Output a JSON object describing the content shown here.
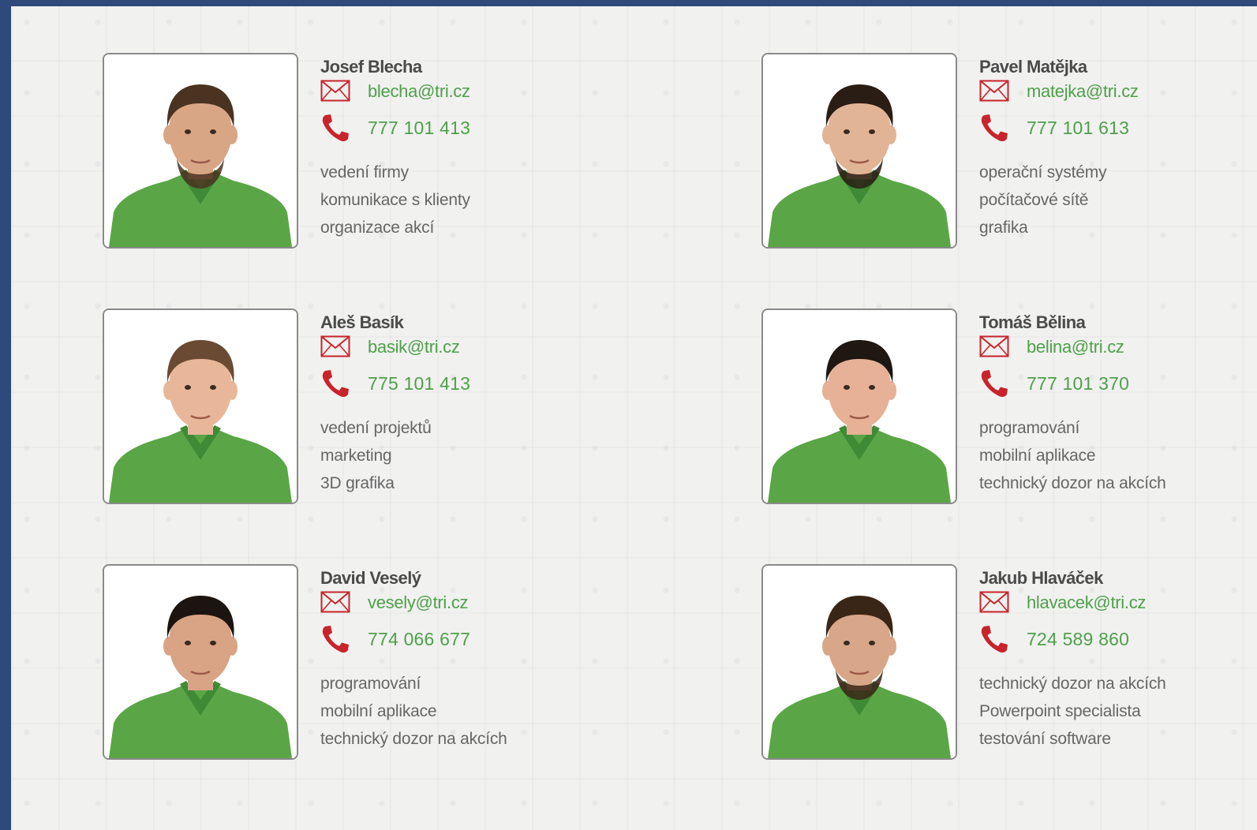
{
  "accent_green": "#4ea04a",
  "phone_red": "#c8242b",
  "people": [
    {
      "name": "Josef Blecha",
      "email": "blecha@tri.cz",
      "phone": "777 101 413",
      "skills": [
        "vedení firmy",
        "komunikace s klienty",
        "organizace akcí"
      ],
      "photo_icon": "person-photo"
    },
    {
      "name": "Pavel Matějka",
      "email": "matejka@tri.cz",
      "phone": "777 101 613",
      "skills": [
        "operační systémy",
        "počítačové sítě",
        "grafika"
      ],
      "photo_icon": "person-photo"
    },
    {
      "name": "Aleš Basík",
      "email": "basik@tri.cz",
      "phone": "775 101 413",
      "skills": [
        "vedení projektů",
        "marketing",
        "3D grafika"
      ],
      "photo_icon": "person-photo"
    },
    {
      "name": "Tomáš Bělina",
      "email": "belina@tri.cz",
      "phone": "777 101 370",
      "skills": [
        "programování",
        "mobilní aplikace",
        "technický dozor na akcích"
      ],
      "photo_icon": "person-photo"
    },
    {
      "name": "David Veselý",
      "email": "vesely@tri.cz",
      "phone": "774 066 677",
      "skills": [
        "programování",
        "mobilní aplikace",
        "technický dozor na akcích"
      ],
      "photo_icon": "person-photo"
    },
    {
      "name": "Jakub Hlaváček",
      "email": "hlavacek@tri.cz",
      "phone": "724 589 860",
      "skills": [
        "technický dozor na akcích",
        "Powerpoint specialista",
        "testování software"
      ],
      "photo_icon": "person-photo"
    }
  ]
}
